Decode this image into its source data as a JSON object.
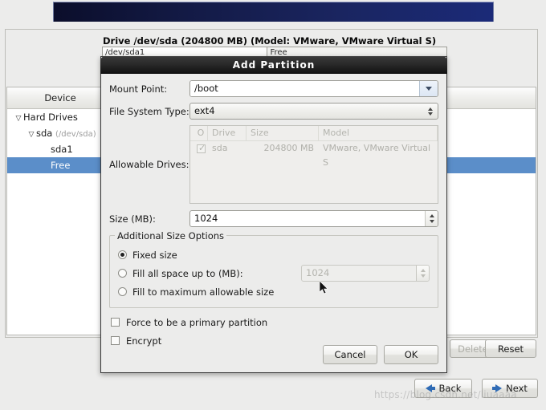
{
  "banner": {
    "name": "installer-banner"
  },
  "main": {
    "drive_heading": "Drive /dev/sda (204800 MB) (Model: VMware, VMware Virtual S)",
    "partition_bar": [
      {
        "label": "/dev/sda1"
      },
      {
        "label": "Free"
      }
    ],
    "tree_headers": [
      "Device",
      "",
      "",
      ""
    ],
    "tree_rows": [
      {
        "twisty": "▽",
        "label": "Hard Drives",
        "sub": "",
        "indent": 1,
        "selected": false
      },
      {
        "twisty": "▽",
        "label": "sda",
        "sub": "(/dev/sda)",
        "indent": 2,
        "selected": false
      },
      {
        "twisty": "",
        "label": "sda1",
        "sub": "",
        "indent": 3,
        "selected": false
      },
      {
        "twisty": "",
        "label": "Free",
        "sub": "",
        "indent": 3,
        "selected": true
      }
    ],
    "buttons": {
      "delete": "Delete",
      "reset": "Reset",
      "back": "Back",
      "next": "Next"
    }
  },
  "watermark": "https://blog.csdn.net/liuaaaa",
  "dialog": {
    "title": "Add Partition",
    "mount_point": {
      "label": "Mount Point:",
      "value": "/boot"
    },
    "fs_type": {
      "label": "File System Type:",
      "value": "ext4"
    },
    "allowable_drives": {
      "label": "Allowable Drives:",
      "headers": [
        "O",
        "Drive",
        "Size",
        "Model"
      ],
      "rows": [
        {
          "checked": "✓",
          "drive": "sda",
          "size": "204800 MB",
          "model": "VMware, VMware Virtual S"
        }
      ]
    },
    "size": {
      "label": "Size (MB):",
      "value": "1024"
    },
    "size_options": {
      "legend": "Additional Size Options",
      "options": [
        {
          "label": "Fixed size",
          "selected": true
        },
        {
          "label": "Fill all space up to (MB):",
          "selected": false,
          "value": "1024"
        },
        {
          "label": "Fill to maximum allowable size",
          "selected": false
        }
      ]
    },
    "checkboxes": [
      {
        "label": "Force to be a primary partition",
        "checked": false
      },
      {
        "label": "Encrypt",
        "checked": false
      }
    ],
    "buttons": {
      "cancel": "Cancel",
      "ok": "OK"
    }
  },
  "colors": {
    "selection_blue": "#5b8ec9",
    "banner_blue": "#1b2a78",
    "arrow_blue": "#2f6bb5"
  }
}
